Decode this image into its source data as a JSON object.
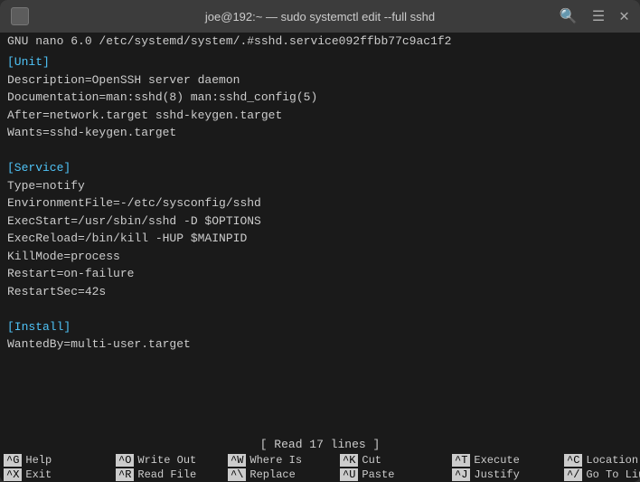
{
  "titlebar": {
    "title": "joe@192:~ — sudo systemctl edit --full sshd",
    "new_tab_icon": "⊞",
    "search_icon": "🔍",
    "menu_icon": "☰",
    "close_icon": "✕"
  },
  "nano_header": {
    "text": "GNU nano 6.0    /etc/systemd/system/.#sshd.service092ffbb77c9ac1f2"
  },
  "editor": {
    "lines": [
      {
        "type": "section",
        "text": "[Unit]"
      },
      {
        "type": "normal",
        "text": "Description=OpenSSH server daemon"
      },
      {
        "type": "normal",
        "text": "Documentation=man:sshd(8) man:sshd_config(5)"
      },
      {
        "type": "normal",
        "text": "After=network.target sshd-keygen.target"
      },
      {
        "type": "normal",
        "text": "Wants=sshd-keygen.target"
      },
      {
        "type": "empty",
        "text": ""
      },
      {
        "type": "section",
        "text": "[Service]"
      },
      {
        "type": "normal",
        "text": "Type=notify"
      },
      {
        "type": "normal",
        "text": "EnvironmentFile=-/etc/sysconfig/sshd"
      },
      {
        "type": "normal",
        "text": "ExecStart=/usr/sbin/sshd -D $OPTIONS"
      },
      {
        "type": "normal",
        "text": "ExecReload=/bin/kill -HUP $MAINPID"
      },
      {
        "type": "normal",
        "text": "KillMode=process"
      },
      {
        "type": "normal",
        "text": "Restart=on-failure"
      },
      {
        "type": "normal",
        "text": "RestartSec=42s"
      },
      {
        "type": "empty",
        "text": ""
      },
      {
        "type": "section",
        "text": "[Install]"
      },
      {
        "type": "normal",
        "text": "WantedBy=multi-user.target"
      }
    ]
  },
  "status": {
    "text": "[ Read 17 lines ]"
  },
  "shortcuts": [
    [
      {
        "key": "^G",
        "label": "Help"
      },
      {
        "key": "^O",
        "label": "Write Out"
      },
      {
        "key": "^W",
        "label": "Where Is"
      },
      {
        "key": "^K",
        "label": "Cut"
      },
      {
        "key": "^T",
        "label": "Execute"
      },
      {
        "key": "^C",
        "label": "Location"
      }
    ],
    [
      {
        "key": "^X",
        "label": "Exit"
      },
      {
        "key": "^R",
        "label": "Read File"
      },
      {
        "key": "^\\",
        "label": "Replace"
      },
      {
        "key": "^U",
        "label": "Paste"
      },
      {
        "key": "^J",
        "label": "Justify"
      },
      {
        "key": "^/",
        "label": "Go To Line"
      }
    ]
  ]
}
